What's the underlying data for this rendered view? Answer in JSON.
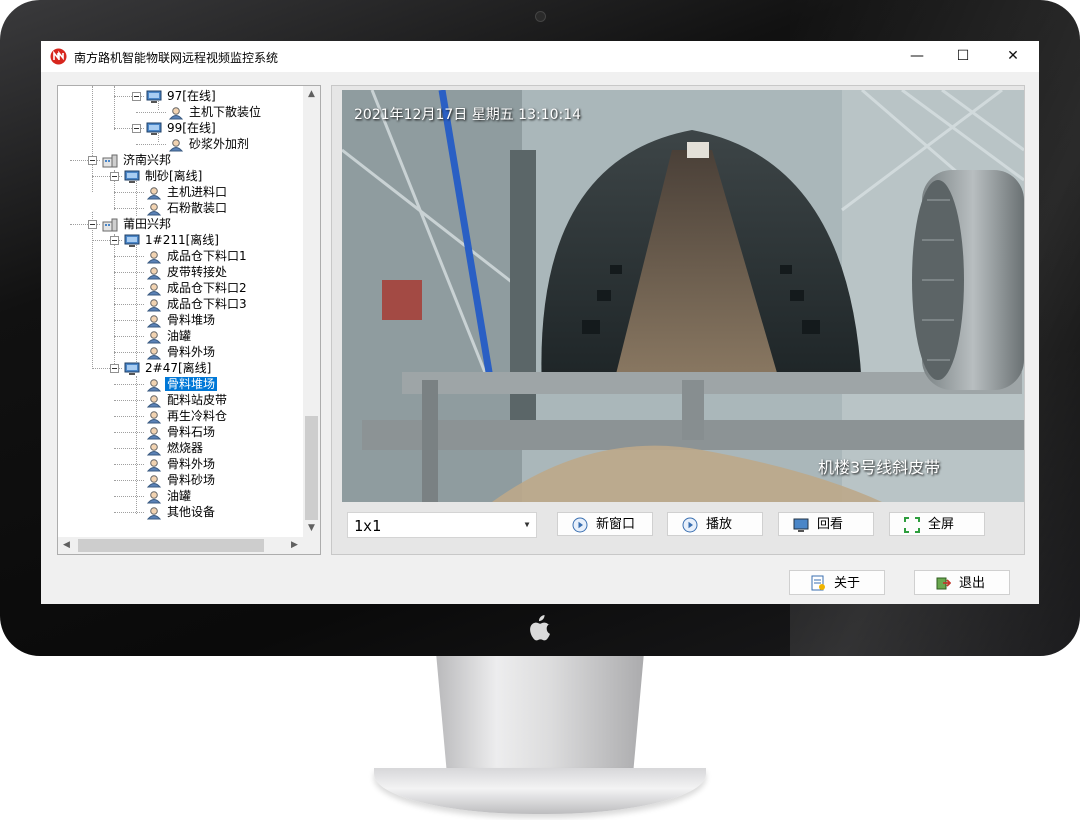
{
  "window": {
    "title": "南方路机智能物联网远程视频监控系统",
    "minimize_glyph": "—",
    "maximize_glyph": "☐",
    "close_glyph": "✕"
  },
  "tree": {
    "items": [
      {
        "label": "97[在线]",
        "type": "camera-group"
      },
      {
        "label": "主机下散装位",
        "type": "camera"
      },
      {
        "label": "99[在线]",
        "type": "camera-group"
      },
      {
        "label": "砂浆外加剂",
        "type": "camera"
      },
      {
        "label": "济南兴邦",
        "type": "site"
      },
      {
        "label": "制砂[离线]",
        "type": "camera-group"
      },
      {
        "label": "主机进料口",
        "type": "camera"
      },
      {
        "label": "石粉散装口",
        "type": "camera"
      },
      {
        "label": "莆田兴邦",
        "type": "site"
      },
      {
        "label": "1#211[离线]",
        "type": "camera-group"
      },
      {
        "label": "成品仓下料口1",
        "type": "camera"
      },
      {
        "label": "皮带转接处",
        "type": "camera"
      },
      {
        "label": "成品仓下料口2",
        "type": "camera"
      },
      {
        "label": "成品仓下料口3",
        "type": "camera"
      },
      {
        "label": "骨料堆场",
        "type": "camera"
      },
      {
        "label": "油罐",
        "type": "camera"
      },
      {
        "label": "骨料外场",
        "type": "camera"
      },
      {
        "label": "2#47[离线]",
        "type": "camera-group"
      },
      {
        "label": "骨料堆场",
        "type": "camera",
        "selected": true
      },
      {
        "label": "配料站皮带",
        "type": "camera"
      },
      {
        "label": "再生冷料仓",
        "type": "camera"
      },
      {
        "label": "骨料石场",
        "type": "camera"
      },
      {
        "label": "燃烧器",
        "type": "camera"
      },
      {
        "label": "骨料外场",
        "type": "camera"
      },
      {
        "label": "骨料砂场",
        "type": "camera"
      },
      {
        "label": "油罐",
        "type": "camera"
      },
      {
        "label": "其他设备",
        "type": "camera"
      }
    ]
  },
  "video": {
    "timestamp": "2021年12月17日  星期五  13:10:14",
    "caption": "机楼3号线斜皮带"
  },
  "controls": {
    "layout_value": "1x1",
    "new_window_label": "新窗口",
    "play_label": "播放",
    "playback_label": "回看",
    "fullscreen_label": "全屏"
  },
  "footer": {
    "about_label": "关于",
    "exit_label": "退出"
  },
  "colors": {
    "selection": "#0078d7",
    "brand_red": "#d7261e"
  }
}
